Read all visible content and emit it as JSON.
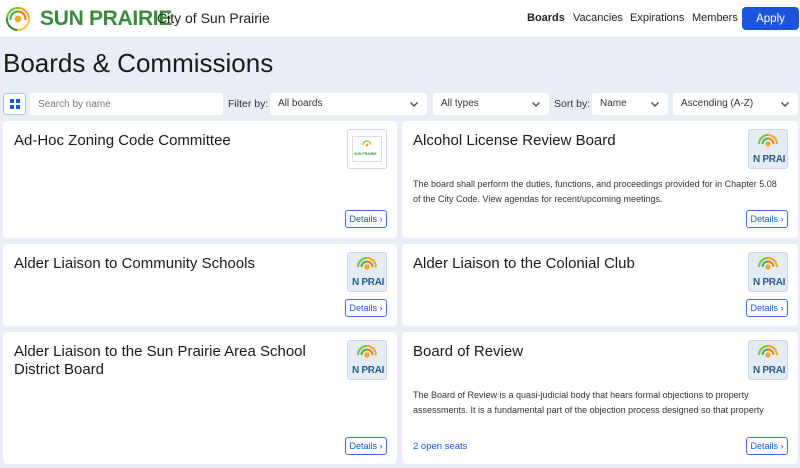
{
  "header": {
    "brand": "SUN PRAIRIE",
    "city": "City of Sun Prairie",
    "nav": [
      "Boards",
      "Vacancies",
      "Expirations",
      "Members"
    ],
    "apply": "Apply"
  },
  "page": {
    "title": "Boards & Commissions"
  },
  "filters": {
    "search_placeholder": "Search by name",
    "filter_label": "Filter by:",
    "boards_value": "All boards",
    "types_value": "All types",
    "sort_label": "Sort by:",
    "sort_value": "Name",
    "order_value": "Ascending (A-Z)"
  },
  "cards": [
    {
      "title": "Ad-Hoc Zoning Code Committee",
      "description": "",
      "seats": "",
      "details": "Details ›",
      "image_logo_text": "SUN PRAIRIE"
    },
    {
      "title": "Alcohol License Review Board",
      "description": "The board shall perform the duties, functions, and proceedings provided for in Chapter 5.08 of the City Code. View agendas for recent/upcoming meetings.",
      "seats": "",
      "details": "Details ›",
      "image_logo_text": "N PRAI"
    },
    {
      "title": "Alder Liaison to Community Schools",
      "description": "",
      "seats": "",
      "details": "Details ›",
      "image_logo_text": "N PRAI"
    },
    {
      "title": "Alder Liaison to the Colonial Club",
      "description": "",
      "seats": "",
      "details": "Details ›",
      "image_logo_text": "N PRAI"
    },
    {
      "title": "Alder Liaison to the Sun Prairie Area School District Board",
      "description": "",
      "seats": "",
      "details": "Details ›",
      "image_logo_text": "N PRAI"
    },
    {
      "title": "Board of Review",
      "description": "The Board of Review is a quasi-judicial body that hears formal objections to property assessments. It is a fundamental part of the objection process designed so that property",
      "seats": "2 open seats",
      "details": "Details ›",
      "image_logo_text": "N PRAI"
    }
  ],
  "colors": {
    "brand_green": "#3a8a3d",
    "primary": "#1a56db",
    "background": "#e8edf6"
  }
}
